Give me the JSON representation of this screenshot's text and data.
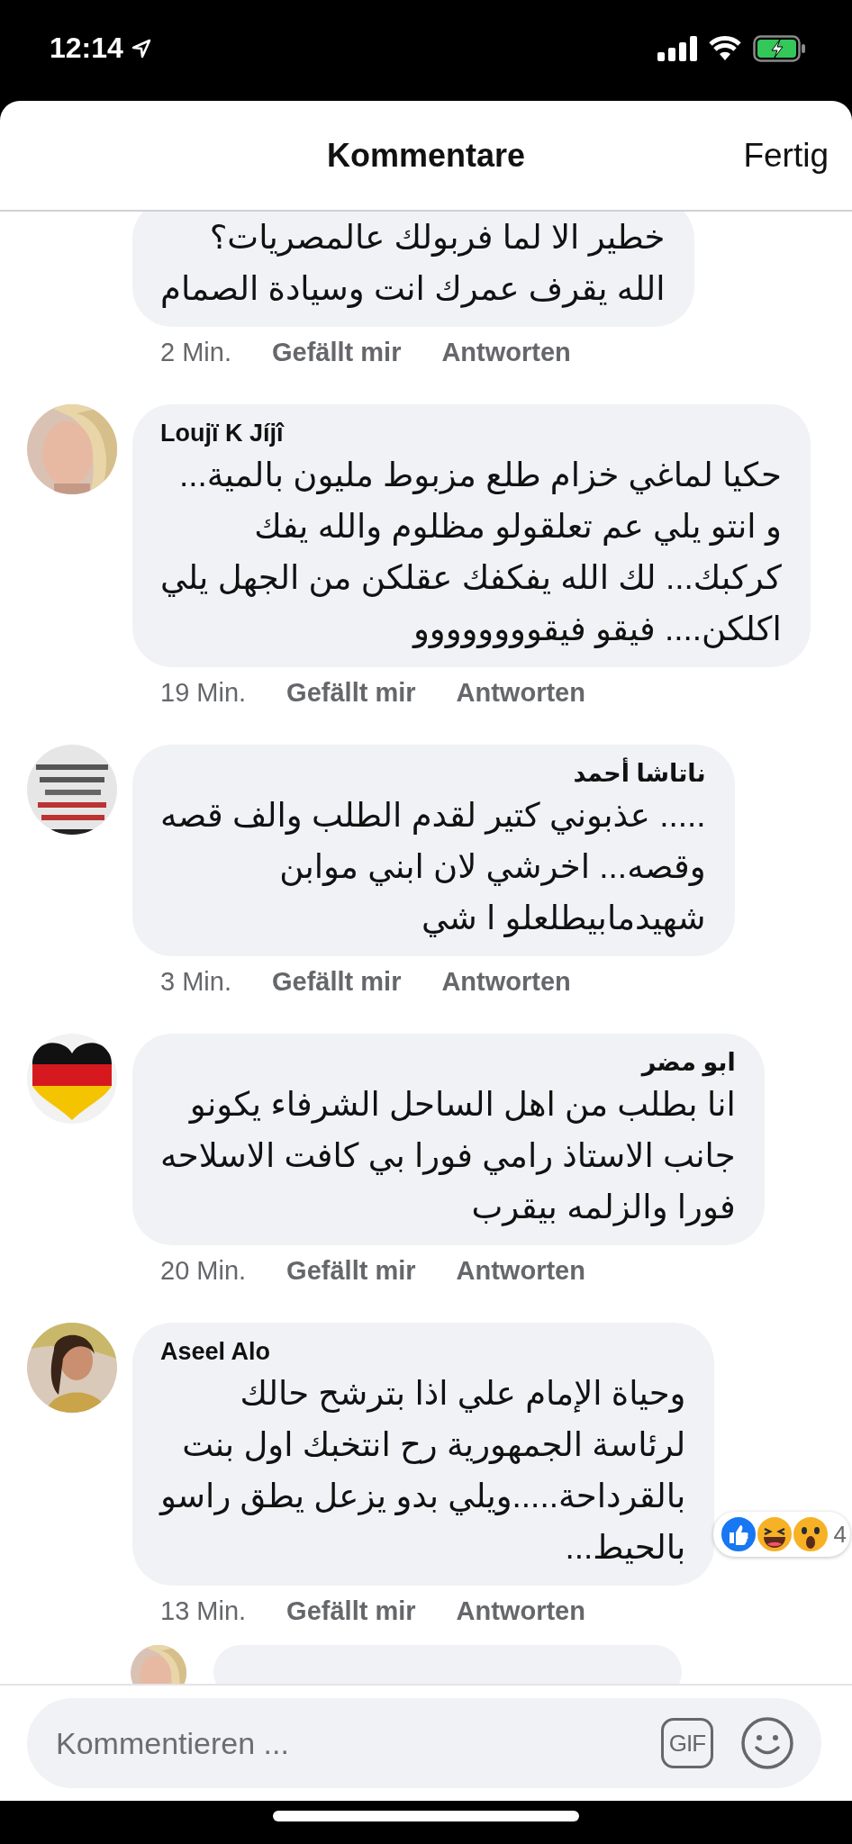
{
  "status_bar": {
    "time": "12:14"
  },
  "header": {
    "title": "Kommentare",
    "done": "Fertig"
  },
  "comments": [
    {
      "lines": [
        "خطير الا لما فربولك عالمصريات؟",
        "الله يقرف عمرك انت وسيادة الصمام"
      ],
      "time": "2 Min.",
      "like": "Gefällt mir",
      "reply": "Antworten"
    },
    {
      "avatar": {
        "kind": "picture"
      },
      "name": "Loujï K Jíjî",
      "lines": [
        "حكيا لماغي خزام طلع مزبوط مليون بالمية...",
        "و انتو يلي عم تعلقولو مظلوم والله يفك",
        "كركبك... لك الله يفكفك عقلكن من الجهل يلي",
        "اكلكن.... فيقو فيقوووووووو"
      ],
      "time": "19 Min.",
      "like": "Gefällt mir",
      "reply": "Antworten"
    },
    {
      "avatar": {
        "kind": "picture"
      },
      "name": "ناتاشا أحمد",
      "lines": [
        "..... عذبوني كتير لقدم الطلب والف قصه",
        "وقصه... اخرشي لان ابني موابن",
        "شهيدمابيطلعلو ا شي"
      ],
      "time": "3 Min.",
      "like": "Gefällt mir",
      "reply": "Antworten"
    },
    {
      "avatar": {
        "kind": "picture"
      },
      "name": "ابو مضر",
      "lines": [
        "انا بطلب من اهل الساحل الشرفاء يكونو",
        "جانب الاستاذ رامي فورا بي كافت الاسلاحه",
        "فورا والزلمه بيقرب"
      ],
      "time": "20 Min.",
      "like": "Gefällt mir",
      "reply": "Antworten"
    },
    {
      "avatar": {
        "kind": "picture"
      },
      "name": "Aseel Alo",
      "lines": [
        "وحياة الإمام علي  اذا بترشح حالك",
        "لرئاسة الجمهورية  رح انتخبك اول بنت",
        "بالقرداحة.....ويلي بدو يزعل يطق راسو",
        "بالحيط..."
      ],
      "time": "13 Min.",
      "like": "Gefällt mir",
      "reply": "Antworten",
      "reactions": {
        "count": "4"
      }
    }
  ],
  "peek": {
    "avatar": {
      "kind": "picture"
    }
  },
  "composer": {
    "placeholder": "Kommentieren ...",
    "gif": "GIF"
  }
}
